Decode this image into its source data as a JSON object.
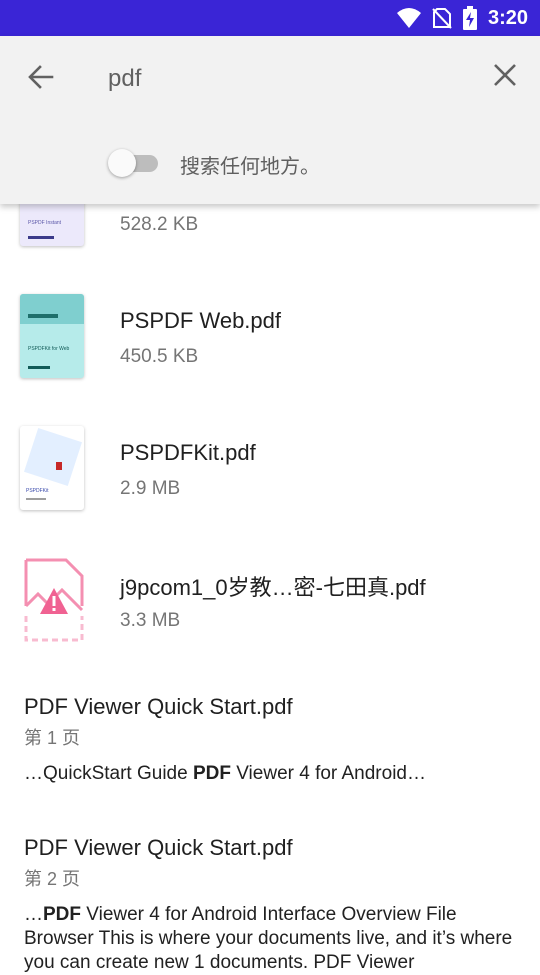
{
  "status_bar": {
    "time": "3:20"
  },
  "search": {
    "query": "pdf",
    "toggle_label": "搜索任何地方。",
    "toggle_on": false
  },
  "files": [
    {
      "name": "",
      "size": "528.2 KB",
      "thumb_text": "PSPDF Instant"
    },
    {
      "name": "PSPDF Web.pdf",
      "size": "450.5 KB",
      "thumb_text": "PSPDFKit for Web"
    },
    {
      "name": "PSPDFKit.pdf",
      "size": "2.9 MB",
      "thumb_text": "PSPDFKit"
    },
    {
      "name": "j9pcom1_0岁教…密-七田真.pdf",
      "size": "3.3 MB",
      "thumb_text": ""
    }
  ],
  "results": [
    {
      "title": "PDF Viewer Quick Start.pdf",
      "page": "第 1 页",
      "snippet_pre": "…QuickStart Guide ",
      "snippet_bold": "PDF",
      "snippet_post": " Viewer 4 for Android…"
    },
    {
      "title": "PDF Viewer Quick Start.pdf",
      "page": "第 2 页",
      "snippet_pre": "…",
      "snippet_bold": "PDF",
      "snippet_post": " Viewer 4 for Android Interface Overview File Browser This is where your documents live, and it’s where you can create new 1 documents. PDF Viewer"
    }
  ],
  "colors": {
    "status_bar": "#3a25d6",
    "search_bg": "#f2f2f2",
    "error_pink": "#f48fb1"
  }
}
